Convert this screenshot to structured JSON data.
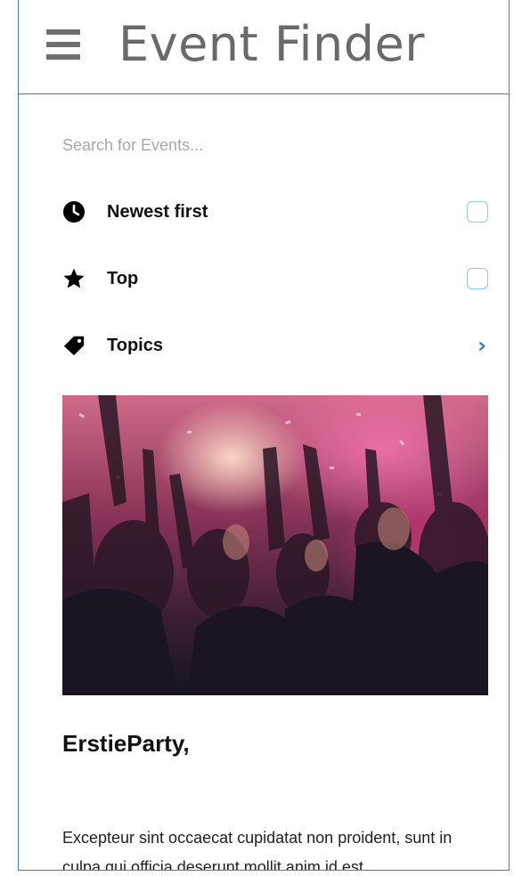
{
  "header": {
    "title": "Event Finder",
    "menu_icon": "hamburger-menu-icon"
  },
  "search": {
    "placeholder": "Search for Events...",
    "value": ""
  },
  "filters": [
    {
      "label": "Newest first",
      "icon": "clock-icon",
      "control": "checkbox",
      "checked": false
    },
    {
      "label": "Top",
      "icon": "star-icon",
      "control": "checkbox",
      "checked": false
    },
    {
      "label": "Topics",
      "icon": "tag-icon",
      "control": "chevron-right"
    }
  ],
  "event": {
    "image": "party-crowd-photo",
    "title": "ErstieParty,",
    "description": "Excepteur sint occaecat cupidatat non proident, sunt in culpa qui officia deserunt mollit anim id est"
  },
  "colors": {
    "border": "#4a78b8",
    "accent": "#2a79d0",
    "checkbox_border": "#9cc2ec",
    "title_text": "#6a6a6a"
  }
}
